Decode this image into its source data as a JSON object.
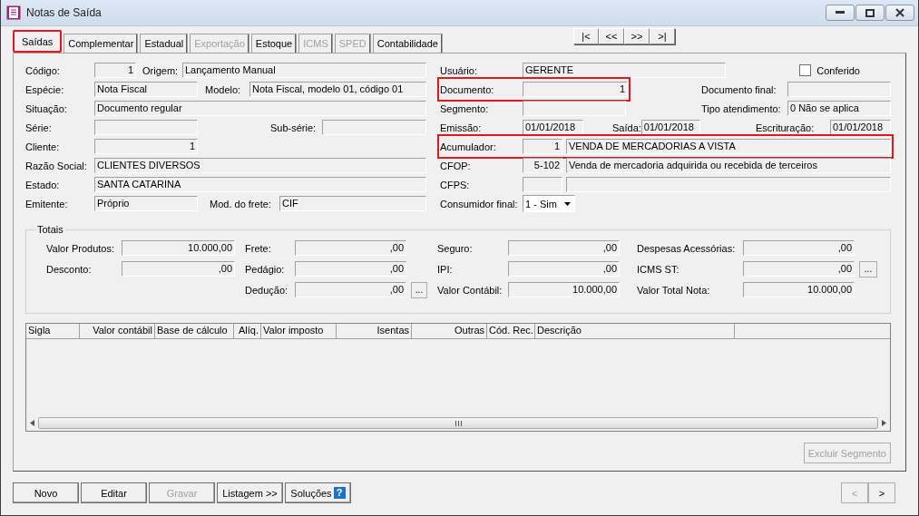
{
  "window": {
    "title": "Notas de Saída"
  },
  "tabs": [
    {
      "label": "Saídas",
      "selected": true,
      "disabled": false,
      "highlighted": true
    },
    {
      "label": "Complementar",
      "selected": false,
      "disabled": false,
      "highlighted": false
    },
    {
      "label": "Estadual",
      "selected": false,
      "disabled": false,
      "highlighted": false
    },
    {
      "label": "Exportação",
      "selected": false,
      "disabled": true,
      "highlighted": false
    },
    {
      "label": "Estoque",
      "selected": false,
      "disabled": false,
      "highlighted": false
    },
    {
      "label": "ICMS",
      "selected": false,
      "disabled": true,
      "highlighted": false
    },
    {
      "label": "SPED",
      "selected": false,
      "disabled": true,
      "highlighted": false
    },
    {
      "label": "Contabilidade",
      "selected": false,
      "disabled": false,
      "highlighted": false
    }
  ],
  "record_nav": [
    "|<",
    "<<",
    ">>",
    ">|"
  ],
  "form": {
    "codigo": {
      "label": "Código:",
      "value": "1"
    },
    "origem": {
      "label": "Origem:",
      "value": "Lançamento Manual"
    },
    "especie": {
      "label": "Espécie:",
      "value": "Nota Fiscal"
    },
    "modelo": {
      "label": "Modelo:",
      "value": "Nota Fiscal, modelo 01, código 01"
    },
    "situacao": {
      "label": "Situação:",
      "value": "Documento regular"
    },
    "serie": {
      "label": "Série:"
    },
    "sub_serie": {
      "label": "Sub-série:"
    },
    "cliente": {
      "label": "Cliente:",
      "value": "1"
    },
    "razao_social": {
      "label": "Razão Social:",
      "value": "CLIENTES DIVERSOS"
    },
    "estado": {
      "label": "Estado:",
      "value": "SANTA CATARINA"
    },
    "emitente": {
      "label": "Emitente:",
      "value": "Próprio"
    },
    "mod_frete": {
      "label": "Mod. do frete:",
      "value": "CIF"
    },
    "usuario": {
      "label": "Usuário:",
      "value": "GERENTE"
    },
    "conferido": {
      "label": "Conferido",
      "checked": false
    },
    "documento": {
      "label": "Documento:",
      "value": "1",
      "highlighted": true
    },
    "documento_final": {
      "label": "Documento final:"
    },
    "segmento": {
      "label": "Segmento:"
    },
    "tipo_atendimento": {
      "label": "Tipo atendimento:",
      "value": "0 Não se aplica"
    },
    "emissao": {
      "label": "Emissão:",
      "value": "01/01/2018"
    },
    "saida": {
      "label": "Saída:",
      "value": "01/01/2018"
    },
    "escrituracao": {
      "label": "Escrituração:",
      "value": "01/01/2018"
    },
    "acumulador": {
      "label": "Acumulador:",
      "code": "1",
      "value": "VENDA DE MERCADORIAS A VISTA",
      "highlighted": true
    },
    "cfop": {
      "label": "CFOP:",
      "code": "5-102",
      "value": "Venda de mercadoria adquirida ou recebida de terceiros"
    },
    "cfps": {
      "label": "CFPS:"
    },
    "consumidor_final": {
      "label": "Consumidor final:",
      "value": "1 - Sim"
    }
  },
  "totals": {
    "title": "Totais",
    "valor_produtos": {
      "label": "Valor Produtos:",
      "value": "10.000,00"
    },
    "frete": {
      "label": "Frete:",
      "value": ",00"
    },
    "seguro": {
      "label": "Seguro:",
      "value": ",00"
    },
    "despesas": {
      "label": "Despesas Acessórias:",
      "value": ",00"
    },
    "desconto": {
      "label": "Desconto:",
      "value": ",00"
    },
    "pedagio": {
      "label": "Pedágio:",
      "value": ",00"
    },
    "ipi": {
      "label": "IPI:",
      "value": ",00"
    },
    "icms_st": {
      "label": "ICMS ST:",
      "value": ",00",
      "button": "..."
    },
    "deducao": {
      "label": "Dedução:",
      "value": ",00",
      "button": "..."
    },
    "valor_contabil": {
      "label": "Valor Contábil:",
      "value": "10.000,00"
    },
    "valor_total": {
      "label": "Valor Total Nota:",
      "value": "10.000,00"
    }
  },
  "table": {
    "columns": [
      {
        "label": "Sigla"
      },
      {
        "label": "Valor contábil"
      },
      {
        "label": "Base de cálculo"
      },
      {
        "label": "Alíq."
      },
      {
        "label": "Valor imposto"
      },
      {
        "label": "Isentas"
      },
      {
        "label": "Outras"
      },
      {
        "label": "Cód. Rec."
      },
      {
        "label": "Descrição"
      }
    ]
  },
  "segment_button": {
    "label": "Excluir Segmento",
    "disabled": true
  },
  "buttons": [
    {
      "label": "Novo",
      "disabled": false
    },
    {
      "label": "Editar",
      "disabled": false
    },
    {
      "label": "Gravar",
      "disabled": true
    },
    {
      "label": "Listagem >>",
      "disabled": false
    },
    {
      "label": "Soluções",
      "disabled": false,
      "help": "?"
    }
  ],
  "page_nav": [
    {
      "label": "<",
      "disabled": true
    },
    {
      "label": ">",
      "disabled": false
    }
  ]
}
